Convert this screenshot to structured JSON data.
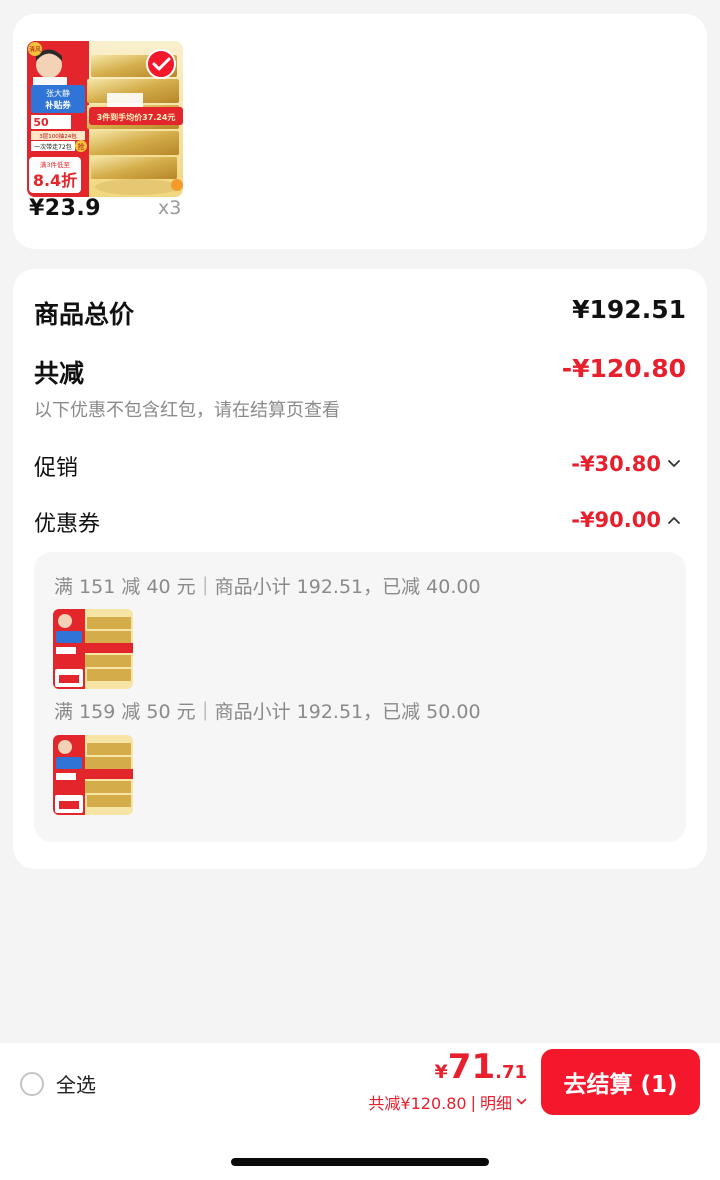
{
  "product": {
    "price": "¥23.9",
    "quantity": "x3",
    "image_badges": {
      "brand": "清风",
      "subsidy_top": "张大静",
      "subsidy_bottom": "补贴券",
      "coupon_value": "50",
      "promo_banner": "3件到手均价37.24元",
      "ribbon_1": "3层100抽24包",
      "ribbon_2": "一次带走72包",
      "grab": "抢",
      "discount_label": "满3件低至",
      "discount_value": "8.4折"
    }
  },
  "summary": {
    "total_label": "商品总价",
    "total_value": "¥192.51",
    "reduce_label": "共减",
    "reduce_value": "-¥120.80",
    "note": "以下优惠不包含红包，请在结算页查看",
    "promo_label": "促销",
    "promo_value": "-¥30.80",
    "coupon_label": "优惠券",
    "coupon_value": "-¥90.00"
  },
  "coupons": [
    {
      "rule": "满 151 减 40 元｜商品小计 192.51，已减 40.00"
    },
    {
      "rule": "满 159 减 50 元｜商品小计 192.51，已减 50.00"
    }
  ],
  "bottom_bar": {
    "select_all_label": "全选",
    "total_currency": "¥",
    "total_integer": "71",
    "total_decimal": ".71",
    "reduce_text": "共减¥120.80",
    "separator": "|",
    "detail_label": "明细",
    "checkout_label": "去结算 (1)"
  },
  "colors": {
    "accent_red": "#e8202e",
    "button_red": "#f5182c",
    "muted_text": "#8a8a8a",
    "page_bg": "#f4f4f4"
  },
  "icons": {
    "promo_toggle": "chevron-down-icon",
    "coupon_toggle": "chevron-up-icon",
    "detail_toggle": "chevron-down-icon",
    "selected_mark": "check-icon"
  }
}
